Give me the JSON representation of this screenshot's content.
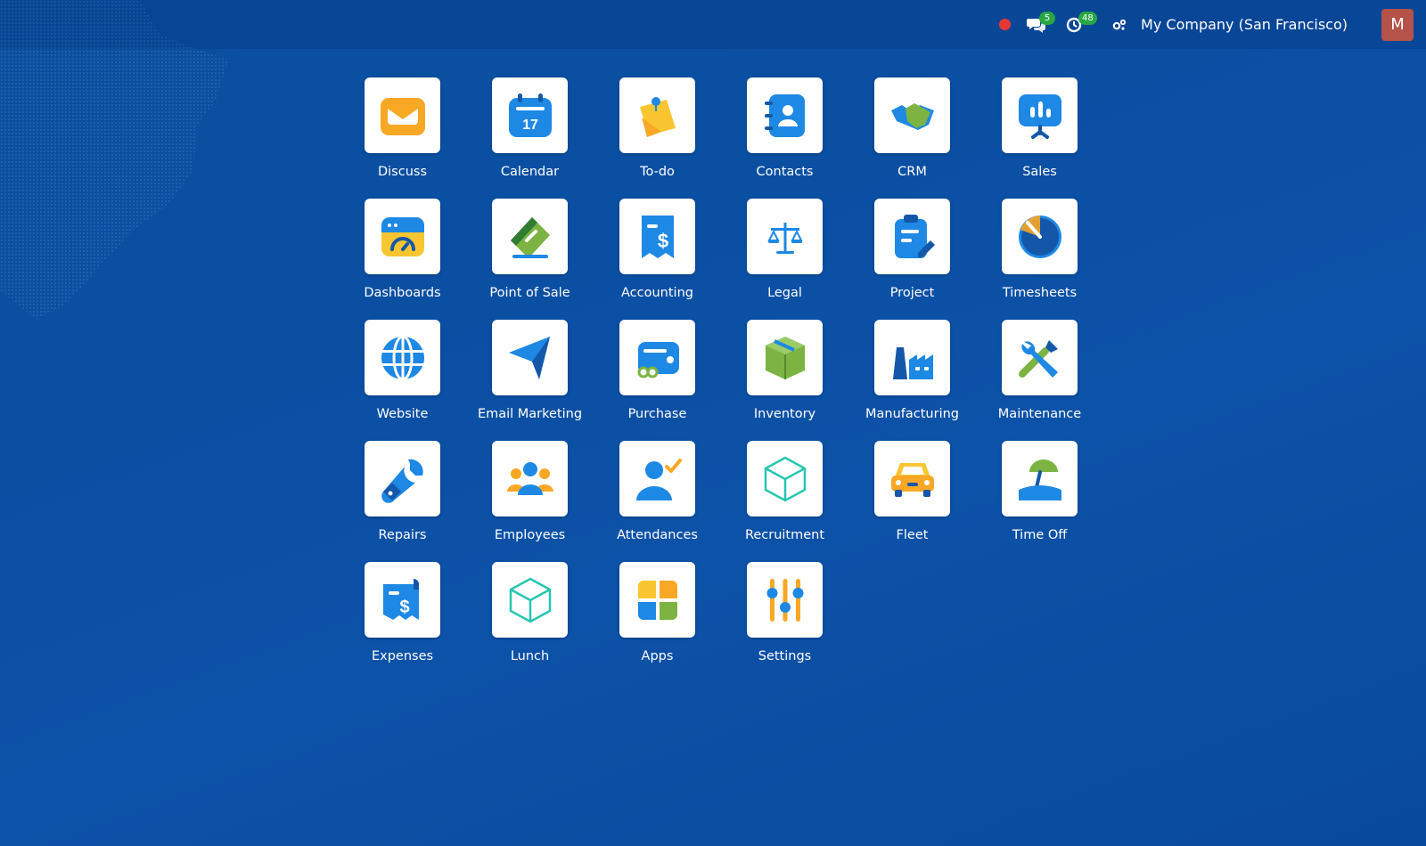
{
  "topbar": {
    "messages_count": "5",
    "activities_count": "48",
    "company": "My Company (San Francisco)",
    "avatar_initial": "M"
  },
  "apps": [
    {
      "label": "Discuss",
      "icon": "discuss-icon"
    },
    {
      "label": "Calendar",
      "icon": "calendar-icon",
      "day": "17"
    },
    {
      "label": "To-do",
      "icon": "todo-icon"
    },
    {
      "label": "Contacts",
      "icon": "contacts-icon"
    },
    {
      "label": "CRM",
      "icon": "crm-icon"
    },
    {
      "label": "Sales",
      "icon": "sales-icon"
    },
    {
      "label": "Dashboards",
      "icon": "dashboards-icon"
    },
    {
      "label": "Point of Sale",
      "icon": "point-of-sale-icon"
    },
    {
      "label": "Accounting",
      "icon": "accounting-icon"
    },
    {
      "label": "Legal",
      "icon": "legal-icon"
    },
    {
      "label": "Project",
      "icon": "project-icon"
    },
    {
      "label": "Timesheets",
      "icon": "timesheets-icon"
    },
    {
      "label": "Website",
      "icon": "website-icon"
    },
    {
      "label": "Email Marketing",
      "icon": "email-marketing-icon"
    },
    {
      "label": "Purchase",
      "icon": "purchase-icon"
    },
    {
      "label": "Inventory",
      "icon": "inventory-icon"
    },
    {
      "label": "Manufacturing",
      "icon": "manufacturing-icon"
    },
    {
      "label": "Maintenance",
      "icon": "maintenance-icon"
    },
    {
      "label": "Repairs",
      "icon": "repairs-icon"
    },
    {
      "label": "Employees",
      "icon": "employees-icon"
    },
    {
      "label": "Attendances",
      "icon": "attendances-icon"
    },
    {
      "label": "Recruitment",
      "icon": "recruitment-icon"
    },
    {
      "label": "Fleet",
      "icon": "fleet-icon"
    },
    {
      "label": "Time Off",
      "icon": "time-off-icon"
    },
    {
      "label": "Expenses",
      "icon": "expenses-icon"
    },
    {
      "label": "Lunch",
      "icon": "lunch-icon"
    },
    {
      "label": "Apps",
      "icon": "apps-icon"
    },
    {
      "label": "Settings",
      "icon": "settings-icon"
    }
  ],
  "colors": {
    "blue": "#1e88e5",
    "dark_blue": "#1457a8",
    "orange": "#f9a825",
    "green": "#7cb342",
    "teal": "#26c6b0",
    "background": "#0b4fa3"
  }
}
